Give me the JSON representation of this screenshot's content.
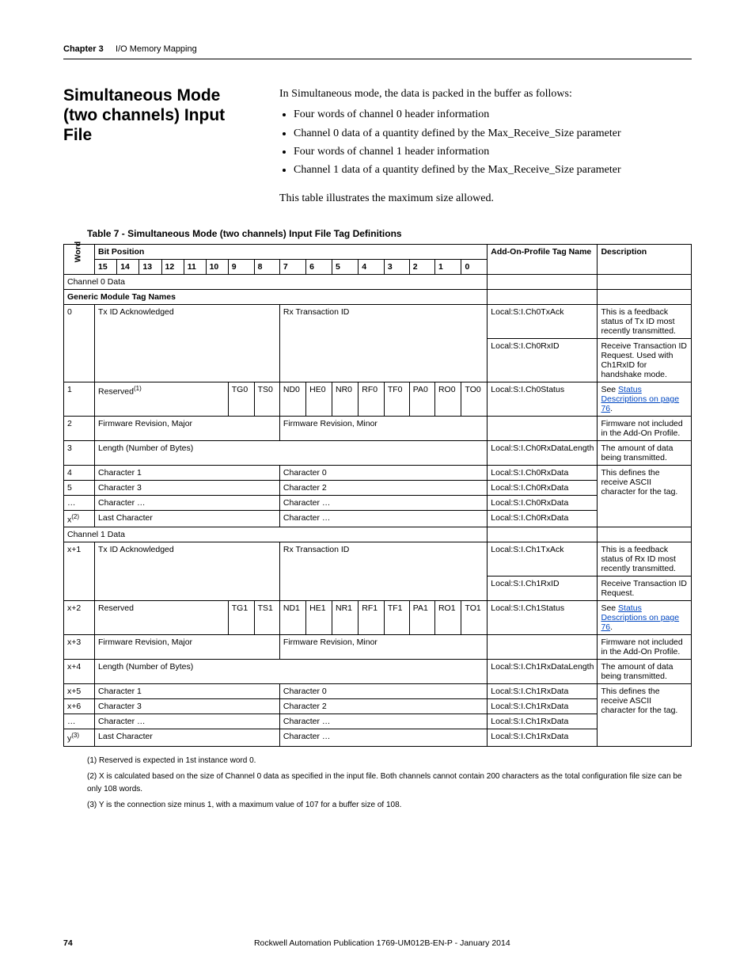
{
  "header": {
    "chapter": "Chapter 3",
    "title": "I/O Memory Mapping"
  },
  "section_title": "Simultaneous Mode (two channels) Input File",
  "intro": "In Simultaneous mode, the data is packed in the buffer as follows:",
  "bullets": [
    "Four words of channel 0 header information",
    "Channel 0 data of a quantity defined by the Max_Receive_Size parameter",
    "Four words of channel 1 header information",
    "Channel 1 data of a quantity defined by the Max_Receive_Size parameter"
  ],
  "intro_tail": "This table illustrates the maximum size allowed.",
  "table_caption": "Table 7 - Simultaneous Mode (two channels) Input File Tag Definitions",
  "columns": {
    "word": "Word",
    "bit_position": "Bit Position",
    "bits": [
      "15",
      "14",
      "13",
      "12",
      "11",
      "10",
      "9",
      "8",
      "7",
      "6",
      "5",
      "4",
      "3",
      "2",
      "1",
      "0"
    ],
    "tag": "Add-On-Profile Tag Name",
    "desc": "Description"
  },
  "sections": {
    "ch0_data": "Channel 0 Data",
    "generic": "Generic Module Tag Names",
    "ch1_data": "Channel 1 Data"
  },
  "rows": {
    "r0": {
      "word": "0",
      "hi": "Tx ID Acknowledged",
      "lo": "Rx Transaction ID",
      "tag1": "Local:S:I.Ch0TxAck",
      "desc1": "This is a feedback status of Tx ID most recently transmitted.",
      "tag2": "Local:S:I.Ch0RxID",
      "desc2": "Receive Transaction ID Request. Used with Ch1RxID for handshake mode."
    },
    "r1": {
      "word": "1",
      "reserved": "Reserved",
      "reserved_sup": "(1)",
      "bits": {
        "b9": "TG0",
        "b8": "TS0",
        "b7": "ND0",
        "b6": "HE0",
        "b5": "NR0",
        "b4": "RF0",
        "b3": "TF0",
        "b2": "PA0",
        "b1": "RO0",
        "b0": "TO0"
      },
      "tag": "Local:S:I.Ch0Status",
      "desc_pre": "See ",
      "desc_link": "Status Descriptions on page 76",
      "desc_post": "."
    },
    "r2": {
      "word": "2",
      "hi": "Firmware Revision, Major",
      "lo": "Firmware Revision, Minor",
      "desc": "Firmware not included in the Add-On Profile."
    },
    "r3": {
      "word": "3",
      "span": "Length (Number of Bytes)",
      "tag": "Local:S:I.Ch0RxDataLength",
      "desc": "The amount of data being transmitted."
    },
    "r4": {
      "word": "4",
      "hi": "Character 1",
      "lo": "Character 0",
      "tag": "Local:S:I.Ch0RxData",
      "desc": "This defines the receive ASCII character for the tag."
    },
    "r5": {
      "word": "5",
      "hi": "Character 3",
      "lo": "Character 2",
      "tag": "Local:S:I.Ch0RxData"
    },
    "r6": {
      "word": "…",
      "hi": "Character …",
      "lo": "Character …",
      "tag": "Local:S:I.Ch0RxData"
    },
    "r7": {
      "word": "x",
      "word_sup": "(2)",
      "hi": "Last Character",
      "lo": "Character …",
      "tag": "Local:S:I.Ch0RxData"
    },
    "r8": {
      "word": "x+1",
      "hi": "Tx ID Acknowledged",
      "lo": "Rx Transaction ID",
      "tag1": "Local:S:I.Ch1TxAck",
      "desc1": "This is a feedback status of Rx ID most recently transmitted.",
      "tag2": "Local:S:I.Ch1RxID",
      "desc2": "Receive Transaction ID Request."
    },
    "r9": {
      "word": "x+2",
      "reserved": "Reserved",
      "bits": {
        "b9": "TG1",
        "b8": "TS1",
        "b7": "ND1",
        "b6": "HE1",
        "b5": "NR1",
        "b4": "RF1",
        "b3": "TF1",
        "b2": "PA1",
        "b1": "RO1",
        "b0": "TO1"
      },
      "tag": "Local:S:I.Ch1Status",
      "desc_pre": "See ",
      "desc_link": "Status Descriptions on page 76",
      "desc_post": "."
    },
    "r10": {
      "word": "x+3",
      "hi": "Firmware Revision, Major",
      "lo": "Firmware Revision, Minor",
      "desc": "Firmware not included in the Add-On Profile."
    },
    "r11": {
      "word": "x+4",
      "span": "Length (Number of Bytes)",
      "tag": "Local:S:I.Ch1RxDataLength",
      "desc": "The amount of data being transmitted."
    },
    "r12": {
      "word": "x+5",
      "hi": "Character 1",
      "lo": "Character 0",
      "tag": "Local:S:I.Ch1RxData",
      "desc": "This defines the receive ASCII character for the tag."
    },
    "r13": {
      "word": "x+6",
      "hi": "Character 3",
      "lo": "Character 2",
      "tag": "Local:S:I.Ch1RxData"
    },
    "r14": {
      "word": "…",
      "hi": "Character …",
      "lo": "Character …",
      "tag": "Local:S:I.Ch1RxData"
    },
    "r15": {
      "word": "y",
      "word_sup": "(3)",
      "hi": "Last Character",
      "lo": "Character …",
      "tag": "Local:S:I.Ch1RxData"
    }
  },
  "footnotes": [
    "(1)   Reserved is expected in 1st instance word 0.",
    "(2)   X is calculated based on the size of Channel 0 data as specified in the input file. Both channels cannot contain 200 characters as the total configuration file size can be only 108 words.",
    "(3)   Y is the connection size minus 1, with a maximum value of 107 for a buffer size of 108."
  ],
  "footer": {
    "page": "74",
    "pub": "Rockwell Automation Publication 1769-UM012B-EN-P - January 2014"
  }
}
